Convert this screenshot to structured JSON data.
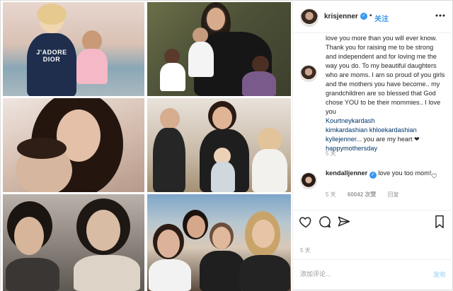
{
  "header": {
    "username": "krisjenner",
    "verified_glyph": "✓",
    "separator": "•",
    "follow_label": "关注",
    "more_icon": "more-horizontal-icon"
  },
  "media": {
    "shirt_line1": "J'ADORE",
    "shirt_line2": "DIOR"
  },
  "caption": {
    "text": "love you more than you will ever know. Thank you for raising me to be strong and independent and for loving me the way you do. To my beautiful daughters who are moms. I am so proud of you girls and the mothers you have become.. my grandchildren are so blessed that God chose YOU to be their mommies.. I love you",
    "mentions": [
      "Kourtneykardash",
      "kimkardashian",
      "khloekardashian",
      "kyliejenner"
    ],
    "tail": "... you are my heart ❤",
    "hashtag": "happymothersday",
    "time_ago": "5 天"
  },
  "reply": {
    "username": "kendalljenner",
    "verified_glyph": "✓",
    "text": "love you too mom!",
    "time_ago": "5 天",
    "likes": "60042 次赞",
    "reply_label": "回复"
  },
  "actions": {
    "like_icon": "heart-icon",
    "comment_icon": "comment-icon",
    "share_icon": "share-icon",
    "save_icon": "bookmark-icon"
  },
  "footer": {
    "time_ago": "5 天",
    "placeholder": "添加评论...",
    "post_label": "发布"
  },
  "colors": {
    "link": "#3897f0",
    "mention": "#003569",
    "muted": "#999999",
    "border": "#efefef"
  }
}
